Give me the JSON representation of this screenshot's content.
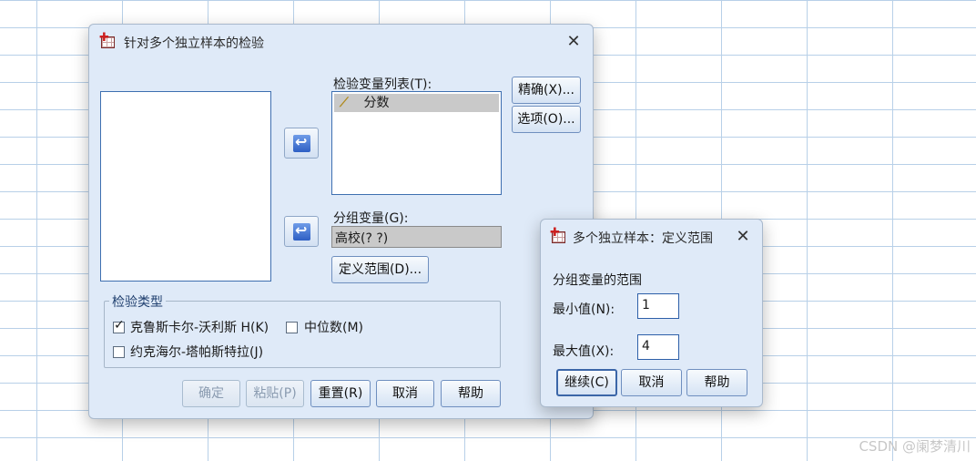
{
  "main_dialog": {
    "title": "针对多个独立样本的检验",
    "test_var_label": "检验变量列表(T):",
    "test_vars": [
      "分数"
    ],
    "group_var_label": "分组变量(G):",
    "group_var_value": "高校(? ?)",
    "define_range_button": "定义范围(D)...",
    "exact_button": "精确(X)...",
    "options_button": "选项(O)...",
    "test_type_legend": "检验类型",
    "tests": {
      "kruskal": {
        "label": "克鲁斯卡尔-沃利斯 H(K)",
        "checked": true
      },
      "median": {
        "label": "中位数(M)",
        "checked": false
      },
      "jonckheere": {
        "label": "约克海尔-塔帕斯特拉(J)",
        "checked": false
      }
    },
    "footer": {
      "ok": "确定",
      "paste": "粘贴(P)",
      "reset": "重置(R)",
      "cancel": "取消",
      "help": "帮助"
    }
  },
  "range_dialog": {
    "title": "多个独立样本：定义范围",
    "section_label": "分组变量的范围",
    "min_label": "最小值(N):",
    "min_value": "1",
    "max_label": "最大值(X):",
    "max_value": "4",
    "continue_button": "继续(C)",
    "cancel_button": "取消",
    "help_button": "帮助"
  },
  "watermark": "CSDN @阑梦清川"
}
